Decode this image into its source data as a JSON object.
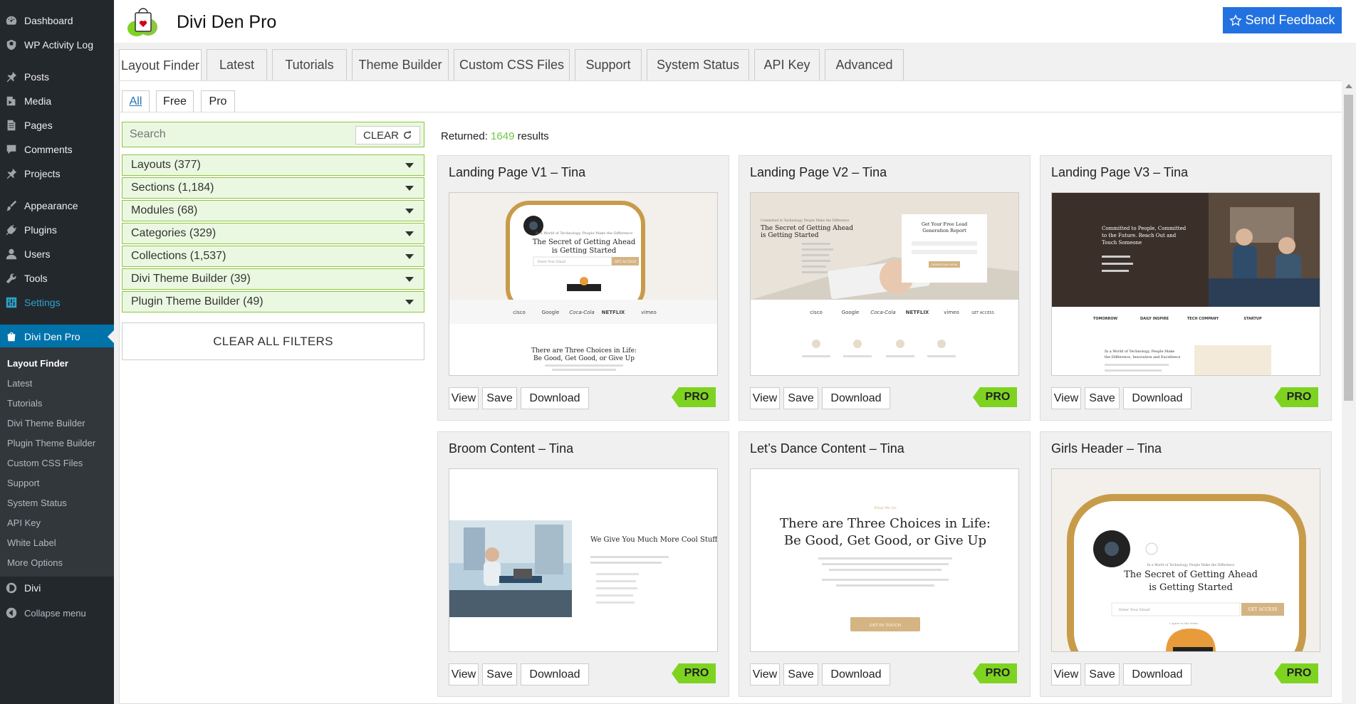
{
  "admin_menu": {
    "items": [
      {
        "label": "Dashboard",
        "icon": "dashboard-icon"
      },
      {
        "label": "WP Activity Log",
        "icon": "shield-icon"
      },
      {
        "label": "Posts",
        "icon": "pin-icon"
      },
      {
        "label": "Media",
        "icon": "media-icon"
      },
      {
        "label": "Pages",
        "icon": "pages-icon"
      },
      {
        "label": "Comments",
        "icon": "comment-icon"
      },
      {
        "label": "Projects",
        "icon": "pin-icon"
      },
      {
        "label": "Appearance",
        "icon": "brush-icon"
      },
      {
        "label": "Plugins",
        "icon": "plug-icon"
      },
      {
        "label": "Users",
        "icon": "user-icon"
      },
      {
        "label": "Tools",
        "icon": "wrench-icon"
      },
      {
        "label": "Settings",
        "icon": "settings-icon"
      },
      {
        "label": "Divi Den Pro",
        "icon": "divi-den-icon"
      },
      {
        "label": "Divi",
        "icon": "divi-icon"
      },
      {
        "label": "Collapse menu",
        "icon": "collapse-icon"
      }
    ],
    "submenu": [
      "Layout Finder",
      "Latest",
      "Tutorials",
      "Divi Theme Builder",
      "Plugin Theme Builder",
      "Custom CSS Files",
      "Support",
      "System Status",
      "API Key",
      "White Label",
      "More Options"
    ]
  },
  "header": {
    "brand": "Divi Den Pro",
    "feedback_label": "Send Feedback"
  },
  "tabs": [
    "Layout Finder",
    "Latest",
    "Tutorials",
    "Theme Builder",
    "Custom CSS Files",
    "Support",
    "System Status",
    "API Key",
    "Advanced"
  ],
  "subtabs": [
    "All",
    "Free",
    "Pro"
  ],
  "search": {
    "placeholder": "Search",
    "clear_label": "CLEAR"
  },
  "filters": [
    "Layouts (377)",
    "Sections (1,184)",
    "Modules (68)",
    "Categories (329)",
    "Collections (1,537)",
    "Divi Theme Builder (39)",
    "Plugin Theme Builder (49)"
  ],
  "clear_all_label": "CLEAR ALL FILTERS",
  "results": {
    "prefix": "Returned:",
    "count": "1649",
    "suffix": "results"
  },
  "card_buttons": {
    "view": "View",
    "save": "Save",
    "download": "Download",
    "badge": "PRO"
  },
  "cards": [
    {
      "title": "Landing Page V1 – Tina",
      "thumb": {
        "headline": "The Secret of Getting Ahead is Getting Started",
        "kicker": "In a World of Technology, People Make the Difference",
        "email": "Enter Your Email",
        "cta": "GET ACCESS",
        "logos": [
          "cisco",
          "Google",
          "Coca-Cola",
          "NETFLIX",
          "vimeo"
        ],
        "footer": "There are Three Choices in Life: Be Good, Get Good, or Give Up"
      }
    },
    {
      "title": "Landing Page V2 – Tina",
      "thumb": {
        "headline": "The Secret of Getting Ahead is Getting Started",
        "kicker": "Committed to Technology, People Make the Difference",
        "form_title": "Get Your Free Lead Generation Report",
        "form_btn": "DOWNLOAD NOW",
        "logos": [
          "cisco",
          "Google",
          "Coca-Cola",
          "NETFLIX",
          "vimeo",
          "GET ACCESS"
        ]
      }
    },
    {
      "title": "Landing Page V3 – Tina",
      "thumb": {
        "headline": "Committed to People, Committed to the Future. Reach Out and Touch Someone",
        "logos": [
          "TOMORROW",
          "DAILY INSPIRE",
          "TECH COMPANY",
          "STARTUP"
        ],
        "sub": "In a World of Technology, People Make the Difference, Innovation and Excellence"
      }
    },
    {
      "title": "Broom Content – Tina",
      "thumb": {
        "headline": "We Give You Much More Cool Stuff"
      }
    },
    {
      "title": "Let’s Dance Content – Tina",
      "thumb": {
        "kicker": "What We Do",
        "headline_1": "There are Three Choices in Life:",
        "headline_2": "Be Good, Get Good, or Give Up",
        "cta": "GET IN TOUCH"
      }
    },
    {
      "title": "Girls Header – Tina",
      "thumb": {
        "kicker": "In a World of Technology, People Make the Difference",
        "headline": "The Secret of Getting Ahead is Getting Started",
        "email": "Enter Your Email",
        "cta": "GET ACCESS",
        "agree": "I agree to the terms"
      }
    }
  ],
  "colors": {
    "accent": "#2271e0",
    "filter_bg": "#ebf8e1",
    "filter_border": "#8dc63f",
    "pro_badge": "#7ed321",
    "count": "#6cc644",
    "admin_bg": "#23282d",
    "admin_active": "#0073aa"
  }
}
